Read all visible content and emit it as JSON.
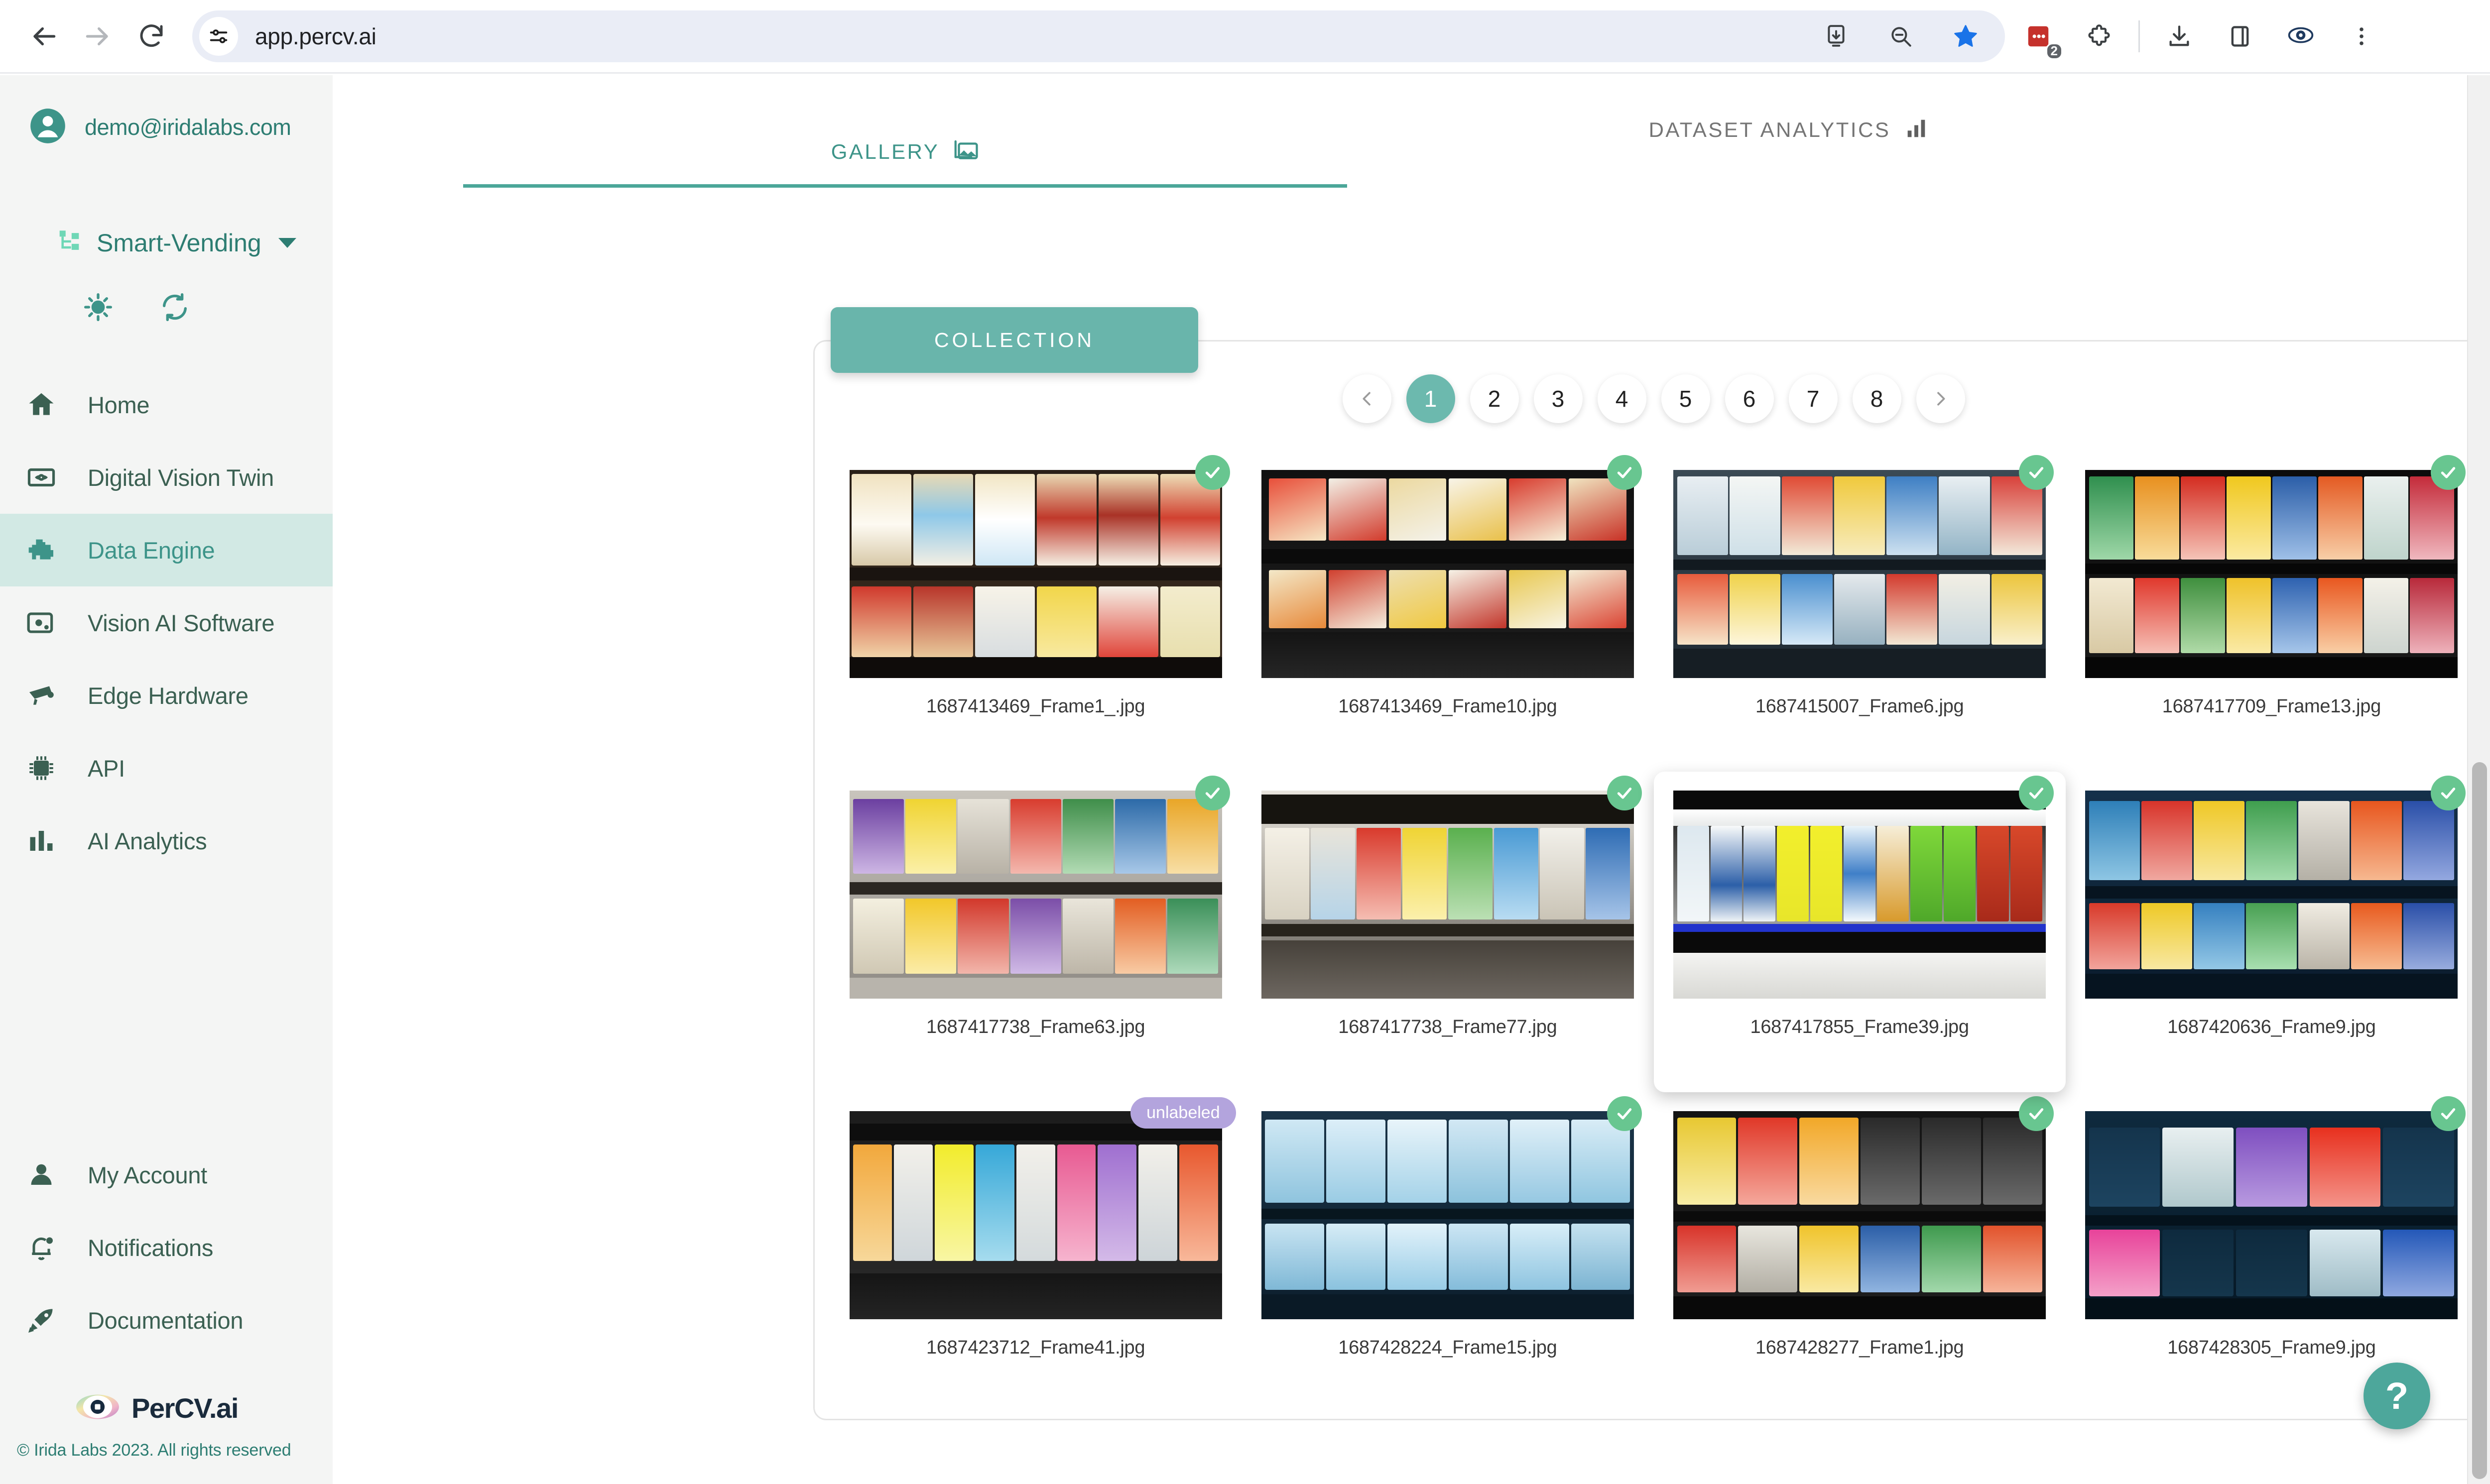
{
  "browser": {
    "url": "app.percv.ai",
    "back_icon": "back-arrow-icon",
    "forward_icon": "forward-arrow-icon",
    "reload_icon": "reload-icon",
    "site_settings_icon": "site-settings-icon",
    "extension_badge_count": "2",
    "icons": [
      "install-app-icon",
      "zoom-out-icon",
      "bookmark-star-icon",
      "extension-red-icon",
      "extension-puzzle-icon",
      "downloads-icon",
      "side-panel-icon",
      "irida-labs-extension-icon",
      "chrome-menu-icon"
    ]
  },
  "sidebar": {
    "account_email": "demo@iridalabs.com",
    "project_name": "Smart-Vending",
    "theme_icon": "sun-icon",
    "sync_icon": "refresh-sync-icon",
    "nav_items": [
      {
        "label": "Home",
        "icon": "home-icon",
        "active": false
      },
      {
        "label": "Digital Vision Twin",
        "icon": "digital-vision-twin-icon",
        "active": false
      },
      {
        "label": "Data Engine",
        "icon": "engine-icon",
        "active": true
      },
      {
        "label": "Vision AI Software",
        "icon": "vision-ai-software-icon",
        "active": false
      },
      {
        "label": "Edge Hardware",
        "icon": "security-camera-icon",
        "active": false
      },
      {
        "label": "API",
        "icon": "chip-icon",
        "active": false
      },
      {
        "label": "AI Analytics",
        "icon": "bar-chart-icon",
        "active": false
      }
    ],
    "bottom_items": [
      {
        "label": "My Account",
        "icon": "person-icon"
      },
      {
        "label": "Notifications",
        "icon": "bell-icon"
      },
      {
        "label": "Documentation",
        "icon": "rocket-icon"
      }
    ],
    "brand_name": "PerCV.ai",
    "brand_icon": "percv-eye-logo",
    "copyright": "© Irida Labs 2023. All rights reserved"
  },
  "main": {
    "tabs": [
      {
        "label": "GALLERY",
        "icon": "gallery-image-icon",
        "active": true
      },
      {
        "label": "DATASET ANALYTICS",
        "icon": "analytics-bar-icon",
        "active": false
      }
    ],
    "collection_label": "COLLECTION",
    "pagination": {
      "prev_icon": "chevron-left-icon",
      "next_icon": "chevron-right-icon",
      "pages": [
        "1",
        "2",
        "3",
        "4",
        "5",
        "6",
        "7",
        "8"
      ],
      "current": "1"
    },
    "gallery": [
      {
        "filename": "1687413469_Frame1_.jpg",
        "badge": "labeled",
        "badge_text": "",
        "hovered": false,
        "theme": "chips-warm"
      },
      {
        "filename": "1687413469_Frame10.jpg",
        "badge": "labeled",
        "badge_text": "",
        "hovered": false,
        "theme": "chips-dark"
      },
      {
        "filename": "1687415007_Frame6.jpg",
        "badge": "labeled",
        "badge_text": "",
        "hovered": false,
        "theme": "drinks-cold"
      },
      {
        "filename": "1687417709_Frame13.jpg",
        "badge": "labeled",
        "badge_text": "",
        "hovered": false,
        "theme": "snacks-bright"
      },
      {
        "filename": "1687417738_Frame63.jpg",
        "badge": "labeled",
        "badge_text": "",
        "hovered": false,
        "theme": "snacks-rows"
      },
      {
        "filename": "1687417738_Frame77.jpg",
        "badge": "labeled",
        "badge_text": "",
        "hovered": false,
        "theme": "bottles-shelf"
      },
      {
        "filename": "1687417855_Frame39.jpg",
        "badge": "labeled",
        "badge_text": "",
        "hovered": true,
        "theme": "bottles-japan"
      },
      {
        "filename": "1687420636_Frame9.jpg",
        "badge": "labeled",
        "badge_text": "",
        "hovered": false,
        "theme": "cans-blue"
      },
      {
        "filename": "1687423712_Frame41.jpg",
        "badge": "unlabeled",
        "badge_text": "unlabeled",
        "hovered": false,
        "theme": "cans-pastel"
      },
      {
        "filename": "1687428224_Frame15.jpg",
        "badge": "labeled",
        "badge_text": "",
        "hovered": false,
        "theme": "water-bottles"
      },
      {
        "filename": "1687428277_Frame1.jpg",
        "badge": "labeled",
        "badge_text": "",
        "hovered": false,
        "theme": "haribo-red"
      },
      {
        "filename": "1687428305_Frame9.jpg",
        "badge": "labeled",
        "badge_text": "",
        "hovered": false,
        "theme": "oreo-navy"
      }
    ],
    "help_label": "?"
  },
  "colors": {
    "accent_teal": "#4ba699",
    "accent_teal_dark": "#2d7d72",
    "sidebar_bg": "#f4f5f4",
    "active_nav_bg": "#d2e9e4",
    "check_green": "#68c690",
    "unlabeled_purple": "#b3a4dd"
  }
}
